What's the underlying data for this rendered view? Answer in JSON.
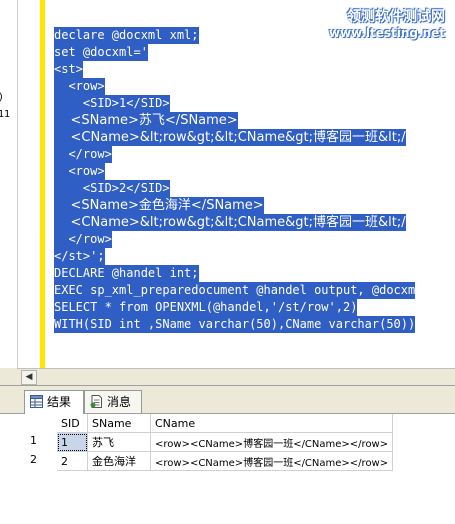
{
  "watermark": {
    "line1": "领测软件测试网",
    "line2": "www.ltesting.net"
  },
  "left_fragments": [
    ")",
    "11"
  ],
  "code_lines": [
    "declare @docxml xml;",
    "set @docxml='",
    "<st>",
    "  <row>",
    "    <SID>1</SID>",
    "    <SName>苏飞</SName>",
    "    <CName>&lt;row&gt;&lt;CName&gt;博客园一班&lt;/",
    "  </row>",
    "  <row>",
    "    <SID>2</SID>",
    "    <SName>金色海洋</SName>",
    "    <CName>&lt;row&gt;&lt;CName&gt;博客园一班&lt;/",
    "  </row>",
    "</st>';",
    "DECLARE @handel int;",
    "EXEC sp_xml_preparedocument @handel output, @docxm",
    "SELECT * from OPENXML(@handel,'/st/row',2)",
    "WITH(SID int ,SName varchar(50),CName varchar(50))"
  ],
  "tabs": [
    {
      "label": "结果",
      "icon": "grid-icon"
    },
    {
      "label": "消息",
      "icon": "messages-icon"
    }
  ],
  "grid": {
    "columns": [
      "SID",
      "SName",
      "CName"
    ],
    "rows": [
      {
        "num": "1",
        "SID": "1",
        "SName": "苏飞",
        "CName": "<row><CName>博客园一班</CName></row>"
      },
      {
        "num": "2",
        "SID": "2",
        "SName": "金色海洋",
        "CName": "<row><CName>博客园一班</CName></row>"
      }
    ]
  },
  "colors": {
    "selection": "#2f5ec4",
    "change_bar": "#ffe600",
    "tab_bar": "#ece9d8"
  }
}
